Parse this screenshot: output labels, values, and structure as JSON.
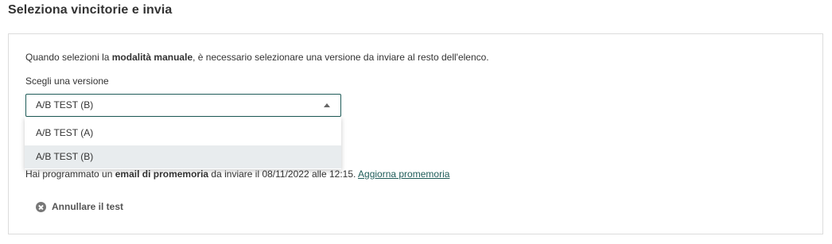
{
  "section": {
    "title": "Seleziona vincitorie e invia"
  },
  "panel": {
    "info": {
      "prefix": "Quando selezioni la ",
      "bold": "modalità manuale",
      "suffix": ", è necessario selezionare una versione da inviare al resto dell'elenco."
    },
    "version_label": "Scegli una versione",
    "select": {
      "value": "A/B TEST (B)",
      "options": [
        "A/B TEST (A)",
        "A/B TEST (B)"
      ],
      "highlighted": "A/B TEST (B)"
    },
    "reminder": {
      "prefix": "Hai programmato un ",
      "bold": "email di promemoria",
      "middle": " da inviare il 08/11/2022 alle 12:15. ",
      "link": "Aggiorna promemoria"
    },
    "cancel_label": "Annullare il test"
  },
  "colors": {
    "accent": "#1f5c59",
    "highlight_row": "#e8ecee",
    "border": "#dcdcdc"
  }
}
